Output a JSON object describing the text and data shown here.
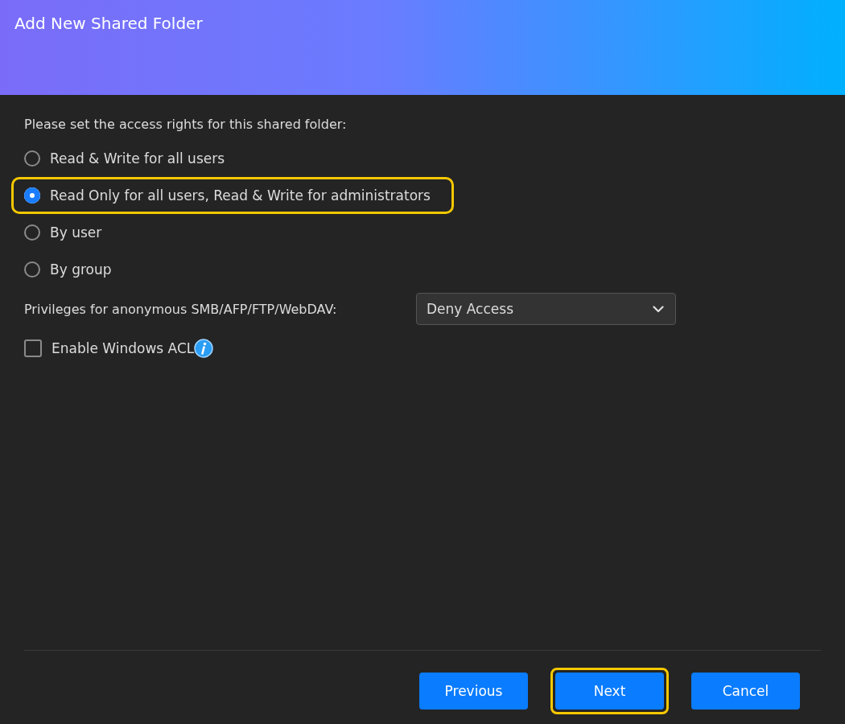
{
  "window": {
    "title": "Add New Shared Folder"
  },
  "prompt": "Please set the access rights for this shared folder:",
  "access_options": [
    {
      "label": "Read & Write for all users",
      "selected": false,
      "highlighted": false
    },
    {
      "label": "Read Only for all users, Read & Write for administrators",
      "selected": true,
      "highlighted": true
    },
    {
      "label": "By user",
      "selected": false,
      "highlighted": false
    },
    {
      "label": "By group",
      "selected": false,
      "highlighted": false
    }
  ],
  "anonymous_privileges": {
    "label": "Privileges for anonymous SMB/AFP/FTP/WebDAV:",
    "value": "Deny Access"
  },
  "windows_acl": {
    "label": "Enable Windows ACL",
    "checked": false
  },
  "buttons": [
    {
      "label": "Previous",
      "highlighted": false
    },
    {
      "label": "Next",
      "highlighted": true
    },
    {
      "label": "Cancel",
      "highlighted": false
    }
  ]
}
